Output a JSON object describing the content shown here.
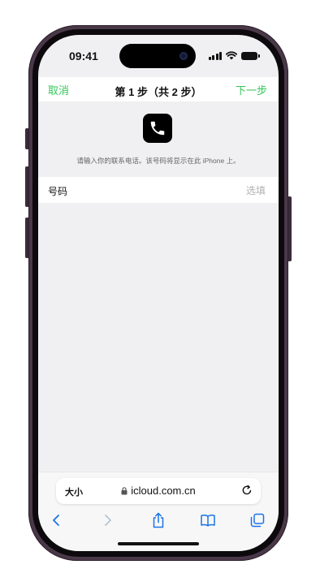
{
  "status": {
    "time": "09:41"
  },
  "nav": {
    "cancel": "取消",
    "title": "第 1 步（共 2 步）",
    "next": "下一步"
  },
  "header": {
    "icon": "phone-icon",
    "instructions": "请输入你的联系电话。该号码将显示在此 iPhone 上。"
  },
  "form": {
    "number_label": "号码",
    "number_placeholder": "选填",
    "number_value": ""
  },
  "safari": {
    "text_size_label": "大小",
    "url": "icloud.com.cn",
    "toolbar_icons": [
      "back-chevron-icon",
      "forward-chevron-icon",
      "share-icon",
      "bookmarks-icon",
      "tabs-icon"
    ]
  },
  "colors": {
    "accent": "#34c759",
    "frame": "#4a3848",
    "screen_bg": "#f0f0f2",
    "toolbar_blue": "#1a73e8"
  }
}
